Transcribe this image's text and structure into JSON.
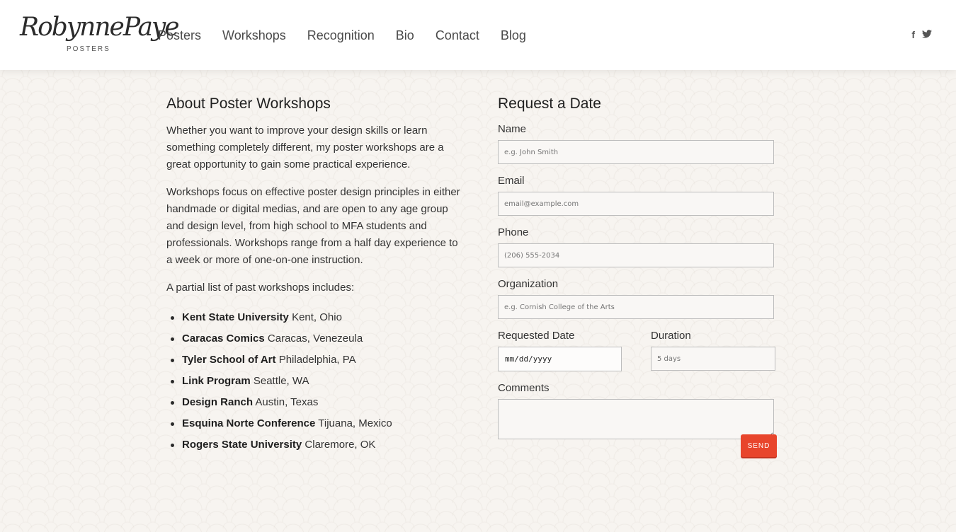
{
  "logo": {
    "script": "RobynnePaye",
    "sub": "POSTERS"
  },
  "nav": [
    "Posters",
    "Workshops",
    "Recognition",
    "Bio",
    "Contact",
    "Blog"
  ],
  "social": {
    "facebook": "f",
    "twitter": "t"
  },
  "about": {
    "title": "About Poster Workshops",
    "p1": "Whether you want to improve your design skills or learn something completely different, my poster workshops are a great opportunity to gain some practical experience.",
    "p2": "Workshops focus on effective poster design principles in either handmade or digital medias, and are open to any age group and design level, from high school to MFA students and professionals. Workshops range from a half day experience to a week or more of one-on-one instruction.",
    "p3": "A partial list of past workshops includes:",
    "workshops": [
      {
        "name": "Kent State University",
        "place": "Kent, Ohio"
      },
      {
        "name": "Caracas Comics",
        "place": "Caracas, Venezeula"
      },
      {
        "name": "Tyler School of Art",
        "place": "Philadelphia, PA"
      },
      {
        "name": "Link Program",
        "place": "Seattle, WA"
      },
      {
        "name": "Design Ranch",
        "place": "Austin, Texas"
      },
      {
        "name": "Esquina Norte Conference",
        "place": "Tijuana, Mexico"
      },
      {
        "name": "Rogers State University",
        "place": "Claremore, OK"
      }
    ]
  },
  "form": {
    "title": "Request a Date",
    "name_label": "Name",
    "name_placeholder": "e.g. John Smith",
    "email_label": "Email",
    "email_placeholder": "email@example.com",
    "phone_label": "Phone",
    "phone_placeholder": "(206) 555-2034",
    "org_label": "Organization",
    "org_placeholder": "e.g. Cornish College of the Arts",
    "date_label": "Requested Date",
    "date_value": "mm/dd/yyyy",
    "duration_label": "Duration",
    "duration_placeholder": "5 days",
    "comments_label": "Comments",
    "send_label": "SEND"
  }
}
